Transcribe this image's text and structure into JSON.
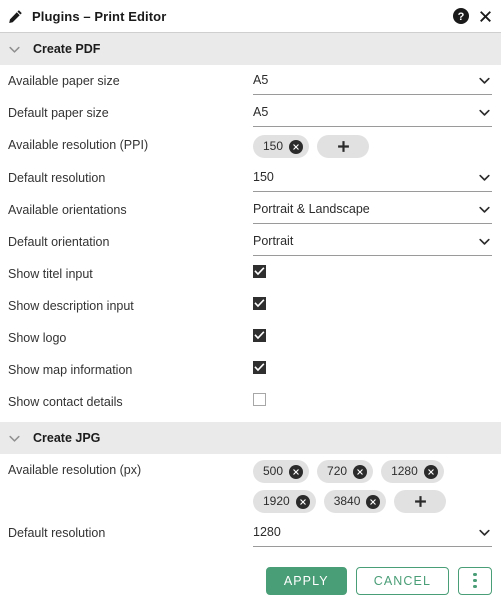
{
  "header": {
    "icon": "pencil-icon",
    "title": "Plugins – Print Editor",
    "help_icon": "help-circle-icon",
    "close_icon": "close-icon"
  },
  "sections": [
    {
      "id": "create-pdf",
      "title": "Create PDF",
      "chevron": "chevron-down-icon",
      "rows": [
        {
          "type": "select",
          "label": "Available paper size",
          "value": "A5"
        },
        {
          "type": "select",
          "label": "Default paper size",
          "value": "A5"
        },
        {
          "type": "chips",
          "label": "Available resolution (PPI)",
          "chips": [
            "150"
          ],
          "add_label": "+"
        },
        {
          "type": "select",
          "label": "Default resolution",
          "value": "150"
        },
        {
          "type": "select",
          "label": "Available orientations",
          "value": "Portrait & Landscape"
        },
        {
          "type": "select",
          "label": "Default orientation",
          "value": "Portrait"
        },
        {
          "type": "checkbox",
          "label": "Show titel input",
          "checked": true
        },
        {
          "type": "checkbox",
          "label": "Show description input",
          "checked": true
        },
        {
          "type": "checkbox",
          "label": "Show logo",
          "checked": true
        },
        {
          "type": "checkbox",
          "label": "Show map information",
          "checked": true
        },
        {
          "type": "checkbox",
          "label": "Show contact details",
          "checked": false
        }
      ]
    },
    {
      "id": "create-jpg",
      "title": "Create JPG",
      "chevron": "chevron-down-icon",
      "rows": [
        {
          "type": "chips",
          "label": "Available resolution (px)",
          "chips": [
            "500",
            "720",
            "1280",
            "1920",
            "3840"
          ],
          "add_label": "+"
        },
        {
          "type": "select",
          "label": "Default resolution",
          "value": "1280"
        }
      ]
    }
  ],
  "footer": {
    "apply_label": "APPLY",
    "cancel_label": "CANCEL",
    "more_icon": "kebab-menu-icon"
  },
  "colors": {
    "accent_green": "#4a9e77",
    "section_band": "#eaeaea",
    "chip_bg": "#e1e1e1",
    "checkbox_on": "#2f2f2f",
    "text": "#333333"
  }
}
